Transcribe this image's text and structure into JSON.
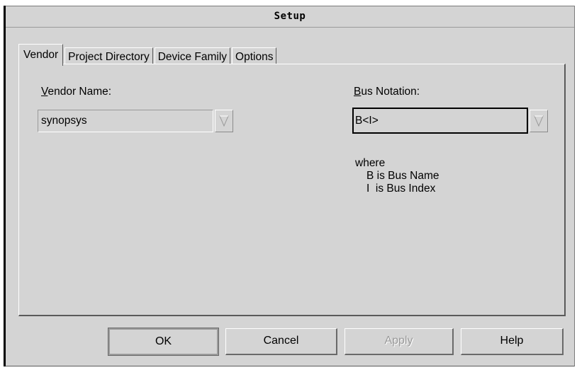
{
  "window": {
    "title": "Setup"
  },
  "tabs": [
    {
      "label": "Vendor",
      "active": true
    },
    {
      "label": "Project Directory",
      "active": false
    },
    {
      "label": "Device Family",
      "active": false
    },
    {
      "label": "Options",
      "active": false
    }
  ],
  "vendor": {
    "label_mnemonic": "V",
    "label_rest": "endor Name:",
    "value": "synopsys",
    "dropdown_icon": "triangle-down-icon"
  },
  "bus": {
    "label_mnemonic": "B",
    "label_rest": "us Notation:",
    "value": "B<I>",
    "dropdown_icon": "triangle-down-icon"
  },
  "where_text": {
    "line1": "where",
    "line2": "B is Bus Name",
    "line3": "I  is Bus Index"
  },
  "buttons": {
    "ok": "OK",
    "cancel": "Cancel",
    "apply": "Apply",
    "help": "Help"
  },
  "colors": {
    "background": "#d4d4d4",
    "highlight": "#ffffff",
    "shadow": "#5a5a5a",
    "disabled_text": "#9a9a9a"
  }
}
